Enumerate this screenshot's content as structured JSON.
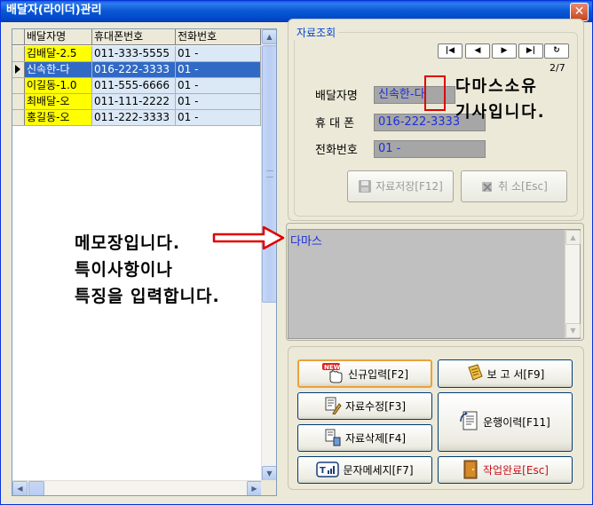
{
  "window": {
    "title": "배달자(라이더)관리",
    "close_label": "✕"
  },
  "grid": {
    "columns": [
      "배달자명",
      "휴대폰번호",
      "전화번호"
    ],
    "rows": [
      {
        "name": "김배달-2.5",
        "mobile": "011-333-5555",
        "phone": "01  -"
      },
      {
        "name": "신속한-다",
        "mobile": "016-222-3333",
        "phone": "01  -"
      },
      {
        "name": "이길동-1.0",
        "mobile": "011-555-6666",
        "phone": "01  -"
      },
      {
        "name": "최배달-오",
        "mobile": "011-111-2222",
        "phone": "01  -"
      },
      {
        "name": "홍길동-오",
        "mobile": "011-222-3333",
        "phone": "01  -"
      }
    ],
    "selected_index": 1
  },
  "lookup": {
    "legend": "자료조회",
    "nav": {
      "first_icon": "first-record-icon",
      "prev_icon": "prev-record-icon",
      "next_icon": "next-record-icon",
      "last_icon": "last-record-icon",
      "refresh_icon": "refresh-icon",
      "first_glyph": "|◀",
      "prev_glyph": "◀",
      "next_glyph": "▶",
      "last_glyph": "▶|",
      "refresh_glyph": "↻"
    },
    "record_counter": "2/7",
    "fields": {
      "name_label": "배달자명",
      "name_value": "신속한-다",
      "mobile_label": "휴 대 폰",
      "mobile_value": "016-222-3333",
      "phone_label": "전화번호",
      "phone_value": "01  -"
    },
    "save_label": "자료저장[F12]",
    "cancel_label": "취 소[Esc]"
  },
  "memo": {
    "value": "다마스"
  },
  "commands": {
    "new_label": "신규입력[F2]",
    "new_badge": "NEW",
    "edit_label": "자료수정[F3]",
    "delete_label": "자료삭제[F4]",
    "sms_label": "문자메세지[F7]",
    "report_label": "보 고 서[F9]",
    "history_label": "운행이력[F11]",
    "done_label": "작업완료[Esc]"
  },
  "annotations": {
    "memo_line1": "메모장입니다.",
    "memo_line2": "특이사항이나",
    "memo_line3": "특징을  입력합니다.",
    "rider_line1": "다마스소유",
    "rider_line2": "기사입니다."
  },
  "colors": {
    "title_bar": "#0a5ad6",
    "name_highlight": "#ffff00",
    "selection": "#316ac5",
    "field_text": "#1a2fdc",
    "annotation_red": "#e00000"
  }
}
